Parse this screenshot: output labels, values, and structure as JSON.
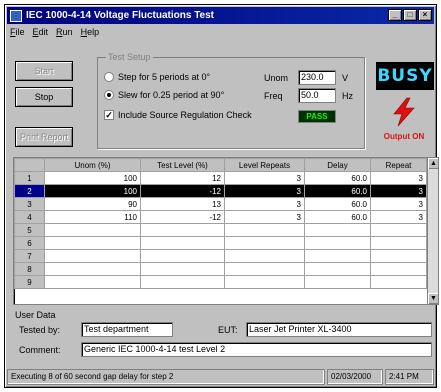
{
  "window": {
    "title": "IEC 1000-4-14 Voltage Fluctuations Test"
  },
  "title_buttons": {
    "minimize": "_",
    "maximize": "□",
    "close": "×"
  },
  "menu": [
    "File",
    "Edit",
    "Run",
    "Help"
  ],
  "buttons": {
    "start": "Start",
    "stop": "Stop",
    "print": "Print Report"
  },
  "test_setup": {
    "label": "Test Setup",
    "option1": "Step for 5 periods at 0°",
    "option2": "Slew for 0.25 period at 90°",
    "selected_option": 2,
    "check_label": "Include Source Regulation Check",
    "check_checked": true,
    "unom_label": "Unom",
    "unom_value": "230.0",
    "unom_unit": "V",
    "freq_label": "Freq",
    "freq_value": "50.0",
    "freq_unit": "Hz",
    "pass_text": "PASS"
  },
  "status_indicator": {
    "busy_text": "BUSY",
    "output_text": "Output ON",
    "colors": {
      "busy": "#3cd6ff",
      "output": "#e01010"
    }
  },
  "table": {
    "headers": [
      "Unom (%)",
      "Test Level (%)",
      "Level Repeats",
      "Delay",
      "Repeat"
    ],
    "selected_row": 2,
    "rows": [
      {
        "num": "1",
        "cells": [
          "100",
          "12",
          "3",
          "60.0",
          "3"
        ]
      },
      {
        "num": "2",
        "cells": [
          "100",
          "-12",
          "3",
          "60.0",
          "3"
        ]
      },
      {
        "num": "3",
        "cells": [
          "90",
          "13",
          "3",
          "60.0",
          "3"
        ]
      },
      {
        "num": "4",
        "cells": [
          "110",
          "-12",
          "3",
          "60.0",
          "3"
        ]
      },
      {
        "num": "5",
        "cells": [
          "",
          "",
          "",
          "",
          ""
        ]
      },
      {
        "num": "6",
        "cells": [
          "",
          "",
          "",
          "",
          ""
        ]
      },
      {
        "num": "7",
        "cells": [
          "",
          "",
          "",
          "",
          ""
        ]
      },
      {
        "num": "8",
        "cells": [
          "",
          "",
          "",
          "",
          ""
        ]
      },
      {
        "num": "9",
        "cells": [
          "",
          "",
          "",
          "",
          ""
        ]
      }
    ]
  },
  "user_data": {
    "group_label": "User Data",
    "tested_by_label": "Tested by:",
    "tested_by_value": "Test department",
    "eut_label": "EUT:",
    "eut_value": "Laser Jet Printer XL-3400",
    "comment_label": "Comment:",
    "comment_value": "Generic IEC 1000-4-14 test Level 2"
  },
  "statusbar": {
    "message": "Executing 8 of 60 second gap delay for step 2",
    "date": "02/03/2000",
    "time": "2:41 PM"
  }
}
